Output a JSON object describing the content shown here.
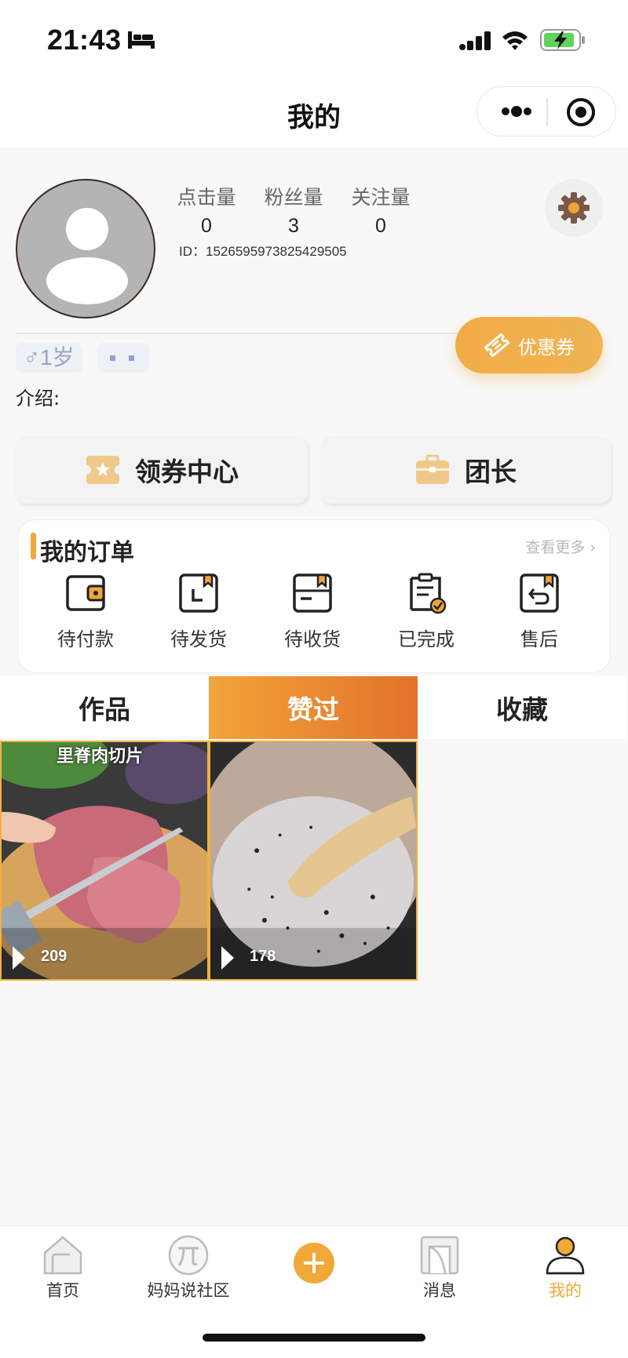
{
  "status_bar": {
    "time": "21:43"
  },
  "nav": {
    "title": "我的"
  },
  "profile": {
    "stats": [
      {
        "label": "点击量",
        "value": "0"
      },
      {
        "label": "粉丝量",
        "value": "3"
      },
      {
        "label": "关注量",
        "value": "0"
      }
    ],
    "user_id": "ID：1526595973825429505",
    "gender_age": "♂1岁",
    "coupon_label": "优惠券",
    "intro_label": "介绍:"
  },
  "quick_actions": [
    {
      "label": "领券中心",
      "icon": "coupon-center-icon"
    },
    {
      "label": "团长",
      "icon": "briefcase-icon"
    }
  ],
  "orders": {
    "title": "我的订单",
    "more_label": "查看更多 ›",
    "items": [
      {
        "label": "待付款",
        "icon": "wallet-icon"
      },
      {
        "label": "待发货",
        "icon": "ship-box-icon"
      },
      {
        "label": "待收货",
        "icon": "receive-box-icon"
      },
      {
        "label": "已完成",
        "icon": "clipboard-check-icon"
      },
      {
        "label": "售后",
        "icon": "return-box-icon"
      }
    ]
  },
  "content_tabs": [
    {
      "label": "作品",
      "active": false
    },
    {
      "label": "赞过",
      "active": true
    },
    {
      "label": "收藏",
      "active": false
    }
  ],
  "videos": [
    {
      "caption": "里脊肉切片",
      "views": "209"
    },
    {
      "caption": "",
      "views": "178"
    }
  ],
  "tabbar": [
    {
      "label": "首页",
      "icon": "home-icon",
      "active": false
    },
    {
      "label": "妈妈说社区",
      "icon": "pi-icon",
      "active": false
    },
    {
      "label": "",
      "icon": "plus-icon",
      "active": false
    },
    {
      "label": "消息",
      "icon": "message-icon",
      "active": false
    },
    {
      "label": "我的",
      "icon": "user-icon",
      "active": true
    }
  ],
  "colors": {
    "accent": "#F2A43A",
    "accent_dark": "#E2722A",
    "text": "#222222"
  }
}
